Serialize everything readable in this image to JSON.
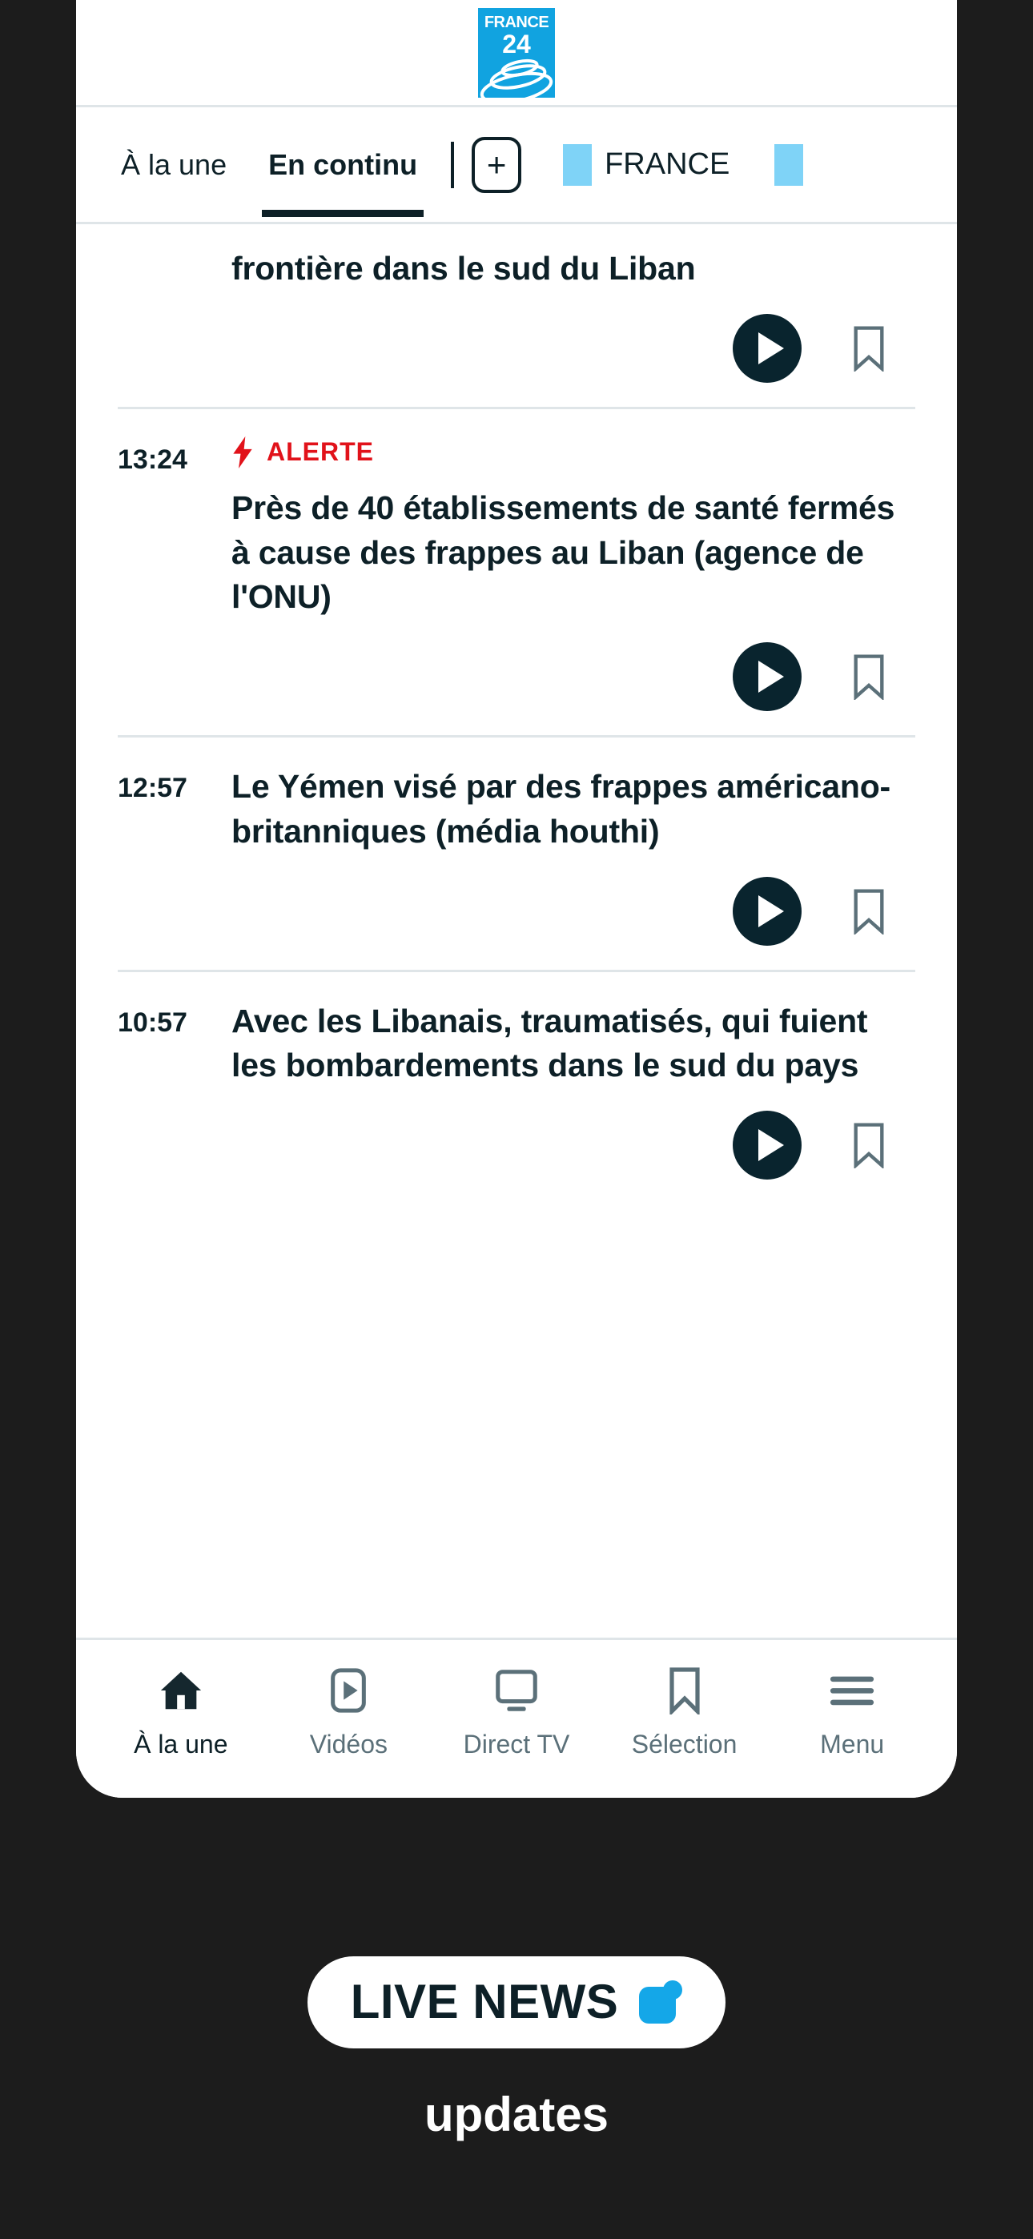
{
  "app": {
    "logo": {
      "word": "FRANCE",
      "number": "24",
      "bg_color": "#11a3e0",
      "icon_name": "france24-logo"
    }
  },
  "tabs": {
    "items": [
      {
        "label": "À la une",
        "active": false
      },
      {
        "label": "En continu",
        "active": true
      }
    ],
    "add_button_label": "+",
    "country": {
      "label": "FRANCE",
      "chip_color": "#7fd3f7"
    }
  },
  "feed": {
    "items": [
      {
        "time": "",
        "alert": "",
        "headline": "frontière dans le sud du Liban",
        "clipped": true,
        "has_play": true,
        "has_bookmark": true
      },
      {
        "time": "13:24",
        "alert": "ALERTE",
        "alert_color": "#e1121a",
        "headline": "Près de 40 établissements de santé fermés à cause des frappes au Liban (agence de l'ONU)",
        "clipped": false,
        "has_play": true,
        "has_bookmark": true
      },
      {
        "time": "12:57",
        "alert": "",
        "headline": "Le Yémen visé par des frappes américano-britanniques (média houthi)",
        "clipped": false,
        "has_play": true,
        "has_bookmark": true
      },
      {
        "time": "10:57",
        "alert": "",
        "headline": "Avec les Libanais, traumatisés, qui fuient les bombardements dans le sud du pays",
        "clipped": false,
        "has_play": true,
        "has_bookmark": true
      }
    ]
  },
  "bottom_nav": {
    "items": [
      {
        "label": "À la une",
        "icon": "home-icon",
        "active": true
      },
      {
        "label": "Vidéos",
        "icon": "video-icon",
        "active": false
      },
      {
        "label": "Direct TV",
        "icon": "tv-icon",
        "active": false
      },
      {
        "label": "Sélection",
        "icon": "bookmark-icon",
        "active": false
      },
      {
        "label": "Menu",
        "icon": "hamburger-icon",
        "active": false
      }
    ]
  },
  "caption": {
    "live_label": "LIVE NEWS",
    "badge_color": "#14a7e8",
    "updates_label": "updates"
  }
}
